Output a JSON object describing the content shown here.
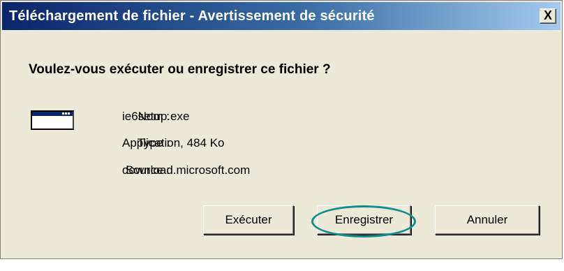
{
  "window": {
    "title": "Téléchargement de fichier - Avertissement de sécurité",
    "close_label": "X"
  },
  "dialog": {
    "question": "Voulez-vous exécuter ou enregistrer ce fichier ?",
    "icon": "application-window-icon",
    "fields": [
      {
        "label": "Nom :",
        "value": "ie6setup.exe"
      },
      {
        "label": "Type :",
        "value": "Application, 484 Ko"
      },
      {
        "label": "Source :",
        "value": "download.microsoft.com"
      }
    ],
    "buttons": {
      "run": "Exécuter",
      "save": "Enregistrer",
      "cancel": "Annuler"
    },
    "highlight_color": "#0e8e8e"
  }
}
